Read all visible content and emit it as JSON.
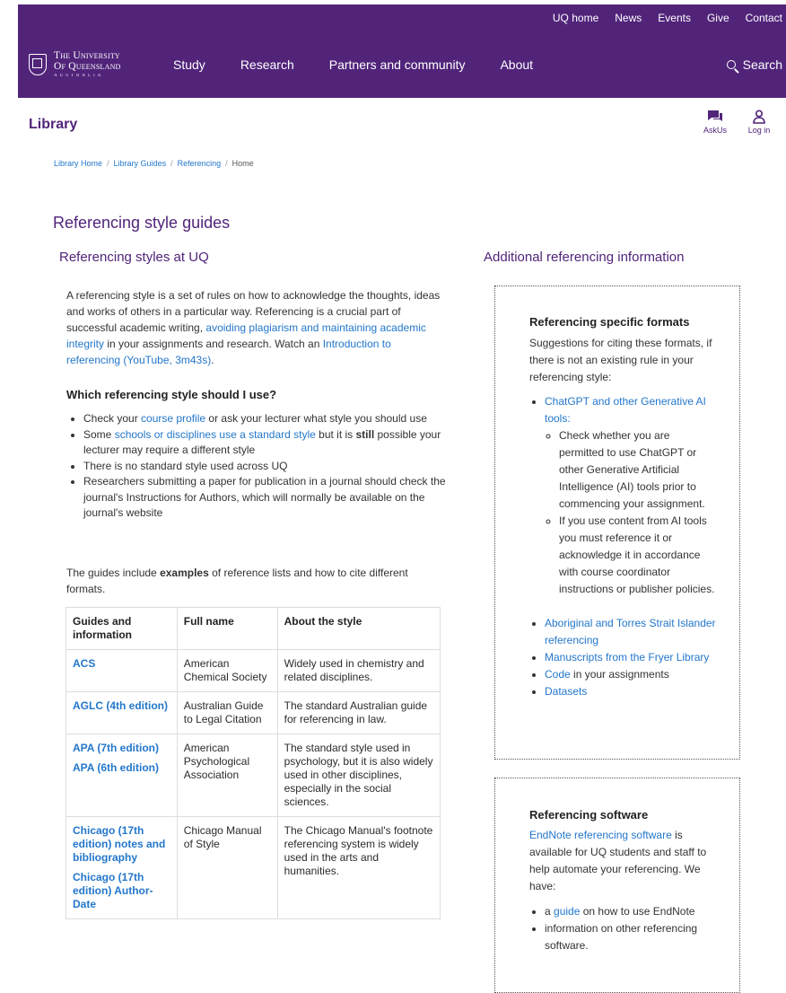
{
  "utility": {
    "links": [
      "UQ home",
      "News",
      "Events",
      "Give",
      "Contact"
    ]
  },
  "logo": {
    "line1": "The University",
    "line2": "Of Queensland",
    "line3": "AUSTRALIA"
  },
  "nav": {
    "items": [
      "Study",
      "Research",
      "Partners and community",
      "About"
    ],
    "search": "Search"
  },
  "library": {
    "title": "Library",
    "askus": "AskUs",
    "login": "Log in"
  },
  "breadcrumb": [
    "Library Home",
    "Library Guides",
    "Referencing",
    "Home"
  ],
  "page_title": "Referencing style guides",
  "left": {
    "heading": "Referencing styles at UQ",
    "intro_1": "A referencing style is a set of rules on how to acknowledge the thoughts, ideas and works of others in a particular way. Referencing is a crucial part of successful academic writing, ",
    "intro_link1": "avoiding plagiarism and maintaining academic integrity",
    "intro_2": " in your assignments and research. Watch an ",
    "intro_link2": "Introduction to referencing (YouTube, 3m43s)",
    "intro_3": ".",
    "question": "Which referencing style should I use?",
    "b1_pre": "Check your ",
    "b1_link": "course profile",
    "b1_post": " or ask your lecturer what style you should use",
    "b2_pre": "Some ",
    "b2_link": "schools or disciplines use a standard style",
    "b2_mid": " but it is ",
    "b2_bold": "still",
    "b2_post": " possible your lecturer may require a different style",
    "b3": "There is no standard style used across UQ",
    "b4": "Researchers submitting a paper for publication in a journal should check the journal's Instructions for Authors, which will normally be available on the journal's website",
    "guides_pre": "The guides include ",
    "guides_bold": "examples",
    "guides_post": " of reference lists and how to cite different formats."
  },
  "table": {
    "headers": [
      "Guides and information",
      "Full name",
      "About the style"
    ],
    "rows": [
      {
        "guides": [
          "ACS"
        ],
        "full": "American Chemical Society",
        "about": "Widely used in chemistry and related disciplines."
      },
      {
        "guides": [
          "AGLC (4th edition)"
        ],
        "full": "Australian Guide to Legal Citation",
        "about": "The standard Australian guide for referencing in law."
      },
      {
        "guides": [
          "APA (7th edition)",
          "APA (6th edition)"
        ],
        "full": "American Psychological Association",
        "about": "The standard style used in psychology, but it is also widely used in other disciplines, especially in the social sciences."
      },
      {
        "guides": [
          "Chicago (17th edition) notes and bibliography",
          "Chicago (17th edition) Author-Date"
        ],
        "full": "Chicago Manual of Style",
        "about": "The Chicago Manual's footnote referencing system is widely used in the arts and humanities."
      }
    ]
  },
  "right": {
    "heading": "Additional referencing information",
    "box1": {
      "title": "Referencing specific formats",
      "intro": "Suggestions for citing these formats, if there is not an existing rule in your referencing style:",
      "ai_link": "ChatGPT and other Generative AI tools:",
      "ai_sub1": "Check whether you are permitted to use ChatGPT or other Generative Artificial Intelligence (AI) tools prior to commencing your assignment.",
      "ai_sub2": "If you use content from AI tools you must reference it or acknowledge it in accordance with course coordinator instructions or publisher policies.",
      "item2": "Aboriginal and Torres Strait Islander referencing",
      "item3": "Manuscripts from the Fryer Library",
      "item4_link": "Code",
      "item4_post": " in your assignments",
      "item5": "Datasets"
    },
    "box2": {
      "title": "Referencing software",
      "link": "EndNote referencing software",
      "text": " is available for UQ students and staff to help automate your referencing. We have:",
      "b1_pre": "a ",
      "b1_link": "guide",
      "b1_post": " on how to use EndNote",
      "b2": "information on other referencing software."
    }
  }
}
